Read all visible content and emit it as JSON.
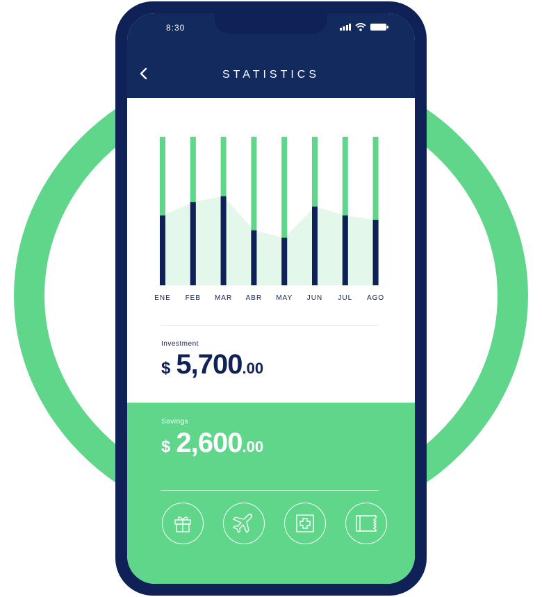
{
  "status_bar": {
    "time": "8:30"
  },
  "header": {
    "title": "STATISTICS"
  },
  "chart_data": {
    "type": "bar",
    "categories": [
      "ENE",
      "FEB",
      "MAR",
      "ABR",
      "MAY",
      "JUN",
      "JUL",
      "AGO"
    ],
    "values": [
      0.47,
      0.56,
      0.6,
      0.37,
      0.32,
      0.53,
      0.47,
      0.44
    ],
    "ylim": [
      0,
      1
    ],
    "colors": {
      "filled": "#0f2157",
      "track": "#5fd68a",
      "area": "#e3f7ea"
    }
  },
  "investment": {
    "label": "Investment",
    "currency": "$",
    "amount": "5,700",
    "cents": ".00"
  },
  "savings": {
    "label": "Savings",
    "currency": "$",
    "amount": "2,600",
    "cents": ".00"
  },
  "categories": [
    {
      "icon": "gift-icon"
    },
    {
      "icon": "airplane-icon"
    },
    {
      "icon": "medical-icon"
    },
    {
      "icon": "ticket-icon"
    }
  ],
  "colors": {
    "navy": "#0f2157",
    "green": "#5fd68a",
    "white": "#ffffff"
  }
}
